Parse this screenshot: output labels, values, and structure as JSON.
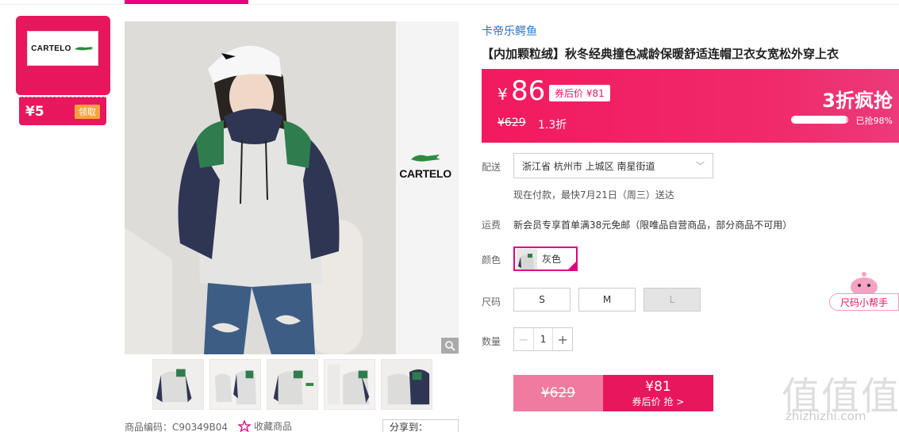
{
  "brand_coupon": {
    "logo_text": "CARTELO",
    "value": "¥5",
    "claim_label": "领取"
  },
  "gallery": {
    "side_logo_text": "CARTELO",
    "thumb_count": 5
  },
  "meta": {
    "product_code": "商品编码：C90349B04",
    "favorite_label": "收藏商品",
    "share_label": "分享到："
  },
  "product": {
    "brand": "卡帝乐鳄鱼",
    "title": "【内加颗粒绒】秋冬经典撞色减龄保暖舒适连帽卫衣女宽松外穿上衣"
  },
  "price": {
    "symbol": "¥",
    "current": "86",
    "after_coupon": "券后价 ¥81",
    "original": "¥629",
    "discount": "1.3折",
    "flash_label": "3折疯抢",
    "sold_percent": 98,
    "sold_text": "已抢98%"
  },
  "delivery": {
    "label": "配送",
    "address": "浙江省 杭州市 上城区 南星街道",
    "note": "现在付款，最快7月21日（周三）送达"
  },
  "shipping": {
    "label": "运费",
    "text": "新会员专享首单满38元免邮（限唯品自营商品，部分商品不可用）"
  },
  "color": {
    "label": "颜色",
    "selected": "灰色"
  },
  "size": {
    "label": "尺码",
    "options": [
      {
        "label": "S",
        "available": true
      },
      {
        "label": "M",
        "available": true
      },
      {
        "label": "L",
        "available": false
      }
    ]
  },
  "quantity": {
    "label": "数量",
    "value": "1",
    "minus": "−",
    "plus": "+"
  },
  "buy": {
    "original": "¥629",
    "price": "¥81",
    "label": "券后价 抢 >"
  },
  "helper": {
    "label": "尺码小帮手"
  },
  "watermark": {
    "text": "值值值",
    "site": "zhizhizhi.com"
  },
  "colors": {
    "accent": "#e8175d",
    "brand_link": "#2a6fc4",
    "magenta": "#e4007f"
  }
}
